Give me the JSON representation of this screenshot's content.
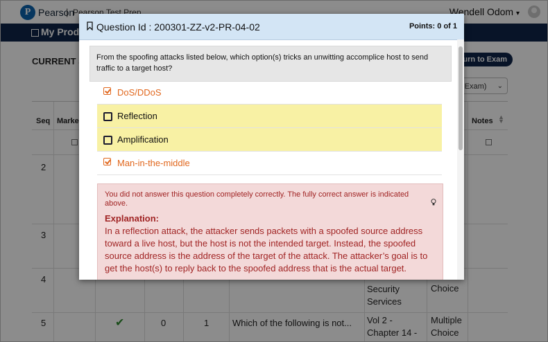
{
  "header": {
    "brand": "Pearson",
    "separator": "|",
    "product": "Pearson Test Prep",
    "user_name": "Wendell Odom",
    "user_caret": "▾"
  },
  "nav": {
    "title": "My Produ"
  },
  "page": {
    "section_title": "CURRENT S",
    "return_button": "turn to Exam",
    "mode_select_value": "ce Exam)"
  },
  "table": {
    "headers": {
      "seq": "Seq",
      "marked": "Marked",
      "notes": "Notes"
    },
    "rows": [
      {
        "seq": "2"
      },
      {
        "seq": "3"
      },
      {
        "seq": "4",
        "chapter": "Security Services",
        "type": "Choice"
      },
      {
        "seq": "5",
        "correct_icon": "✔",
        "col3": "0",
        "col4": "1",
        "question": "Which of the following is not...",
        "chapter": "Vol 2 - Chapter 14 -",
        "type": "Multiple Choice"
      }
    ]
  },
  "modal": {
    "question_id": "Question Id : 200301-ZZ-v2-PR-04-02",
    "points": "Points: 0 of 1",
    "question_text": "From the spoofing attacks listed below, which option(s) tricks an unwitting accomplice host to send traffic to a target host?",
    "options": [
      {
        "label": "DoS/DDoS",
        "state": "correct-unselected"
      },
      {
        "label": "Reflection",
        "state": "selected-wrong"
      },
      {
        "label": "Amplification",
        "state": "selected-wrong"
      },
      {
        "label": "Man-in-the-middle",
        "state": "correct-unselected"
      }
    ],
    "feedback": {
      "message": "You did not answer this question completely correctly. The fully correct answer is indicated above.",
      "explanation_title": "Explanation:",
      "explanation_text": "In a reflection attack, the attacker sends packets with a spoofed source address toward a live host, but the host is not the intended target. Instead, the spoofed source address is the address of the target of the attack. The attacker’s goal is to get the host(s) to reply back to the spoofed address that is the actual target."
    }
  },
  "colors": {
    "nav_bg": "#10264a",
    "modal_header": "#d3e5f5",
    "correct_option": "#e1671d",
    "highlight": "#f8f1a4",
    "feedback_bg": "#f3d9d9",
    "feedback_text": "#a02323",
    "check_green": "#2e8b2e"
  },
  "icons": [
    "bookmark-icon",
    "checkbox-checked-icon",
    "checkbox-icon",
    "lightbulb-icon",
    "checkmark-icon",
    "avatar-icon",
    "sort-icon"
  ]
}
